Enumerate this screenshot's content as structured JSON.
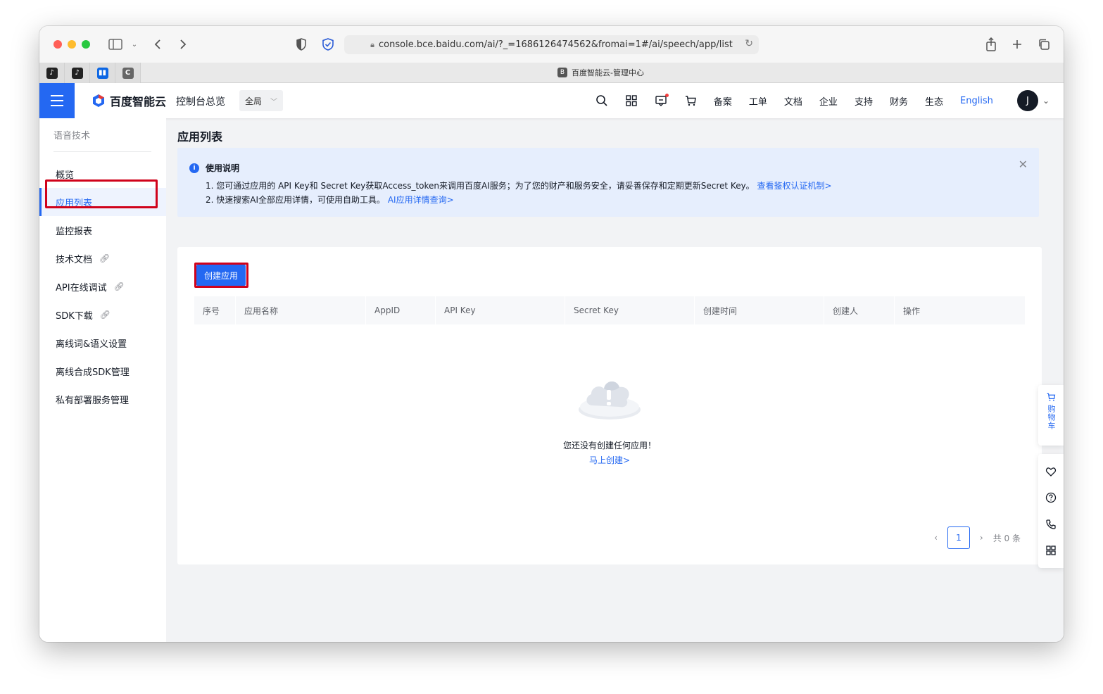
{
  "browser": {
    "url": "console.bce.baidu.com/ai/?_=1686126474562&fromai=1#/ai/speech/app/list",
    "tab_title": "百度智能云-管理中心",
    "tab_favicon": "B",
    "pinned_tab_c": "C"
  },
  "topnav": {
    "logo_text": "百度智能云",
    "console_overview": "控制台总览",
    "region": "全局",
    "links": [
      "备案",
      "工单",
      "文档",
      "企业",
      "支持",
      "财务",
      "生态"
    ],
    "language": "English",
    "avatar_initial": "J"
  },
  "sidebar": {
    "section_title": "语音技术",
    "items": [
      {
        "label": "概览",
        "external": false
      },
      {
        "label": "应用列表",
        "external": false,
        "active": true
      },
      {
        "label": "监控报表",
        "external": false
      },
      {
        "label": "技术文档",
        "external": true
      },
      {
        "label": "API在线调试",
        "external": true
      },
      {
        "label": "SDK下载",
        "external": true
      },
      {
        "label": "离线词&语义设置",
        "external": false
      },
      {
        "label": "离线合成SDK管理",
        "external": false
      },
      {
        "label": "私有部署服务管理",
        "external": false
      }
    ]
  },
  "main": {
    "page_title": "应用列表",
    "notice": {
      "title": "使用说明",
      "line1_text": "1. 您可通过应用的 API Key和 Secret Key获取Access_token来调用百度AI服务；为了您的财产和服务安全，请妥善保存和定期更新Secret Key。",
      "line1_link": "查看鉴权认证机制>",
      "line2_text": "2. 快速搜索AI全部应用详情，可使用自助工具。",
      "line2_link": "AI应用详情查询>"
    },
    "create_button": "创建应用",
    "table": {
      "columns": [
        "序号",
        "应用名称",
        "AppID",
        "API Key",
        "Secret Key",
        "创建时间",
        "创建人",
        "操作"
      ]
    },
    "empty": {
      "text": "您还没有创建任何应用！",
      "action": "马上创建>"
    },
    "pagination": {
      "current_page": "1",
      "total": "共 0 条"
    }
  },
  "float_bar": {
    "cart_label": "购物车"
  },
  "colors": {
    "primary": "#2468f2",
    "highlight_box": "#d0021b",
    "notice_bg": "#e6eefd"
  }
}
